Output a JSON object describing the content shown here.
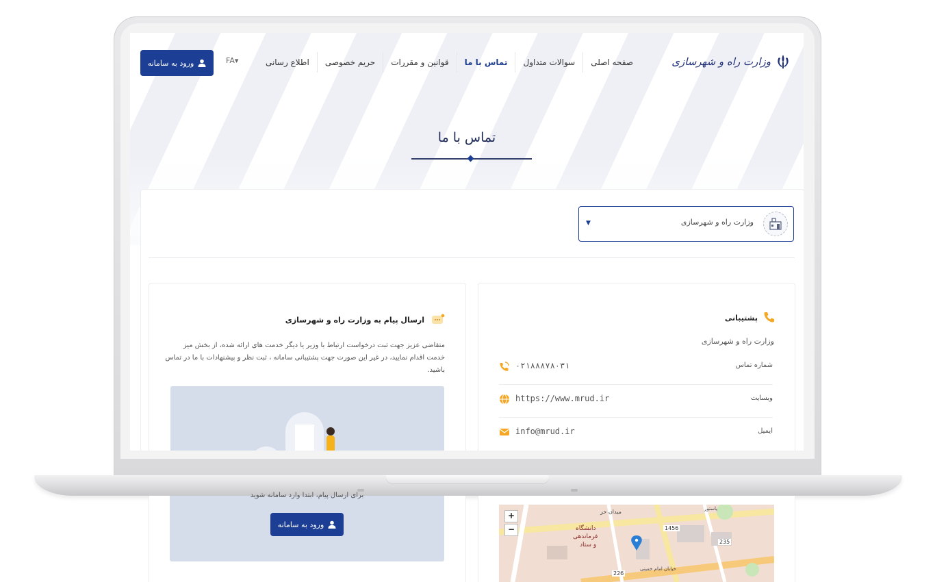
{
  "brand": {
    "name": "وزارت راه و شهرسازی"
  },
  "nav": {
    "items": [
      {
        "label": "صفحه اصلی"
      },
      {
        "label": "سوالات متداول"
      },
      {
        "label": "تماس با ما"
      },
      {
        "label": "قوانین و مقررات"
      },
      {
        "label": "حریم خصوصی"
      },
      {
        "label": "اطلاع رسانی"
      }
    ],
    "active_index": 2
  },
  "language": {
    "label": "FA▾"
  },
  "header": {
    "login_label": "ورود به سامانه"
  },
  "page": {
    "title": "تماس با ما"
  },
  "org_select": {
    "value": "وزارت راه و شهرسازی"
  },
  "message_card": {
    "title": "ارسال پیام به وزارت راه و شهرسازی",
    "description": "متقاضی عزیز جهت ثبت درخواست ارتباط با وزیر یا دیگر خدمت های ارائه شده، از بخش میز خدمت اقدام نمایید، در غیر این صورت جهت پشتیبانی سامانه ، ثبت نظر و پیشنهادات با ما در تماس باشید.",
    "login_prompt": "برای ارسال پیام، ابتدا وارد سامانه شوید",
    "login_label": "ورود به سامانه"
  },
  "support_card": {
    "title": "پشتیبانی",
    "org": "وزارت راه و شهرسازی",
    "rows": [
      {
        "label": "شماره تماس",
        "value": "۰۲۱۸۸۸۷۸۰۳۱",
        "icon": "phone-icon"
      },
      {
        "label": "وبسایت",
        "value": "https://www.mrud.ir",
        "icon": "globe-icon"
      },
      {
        "label": "ایمیل",
        "value": "info@mrud.ir",
        "icon": "mail-icon"
      }
    ]
  },
  "map": {
    "zoom_in": "+",
    "zoom_out": "−",
    "labels": [
      "میدان حر",
      "دانشگاه",
      "فرماندهی",
      "و ستاد",
      "1456",
      "235",
      "226",
      "پاستور",
      "خیابان امام خمینی"
    ]
  },
  "colors": {
    "primary": "#1c3f95",
    "accent": "#f5a623",
    "title": "#1d2a55"
  }
}
